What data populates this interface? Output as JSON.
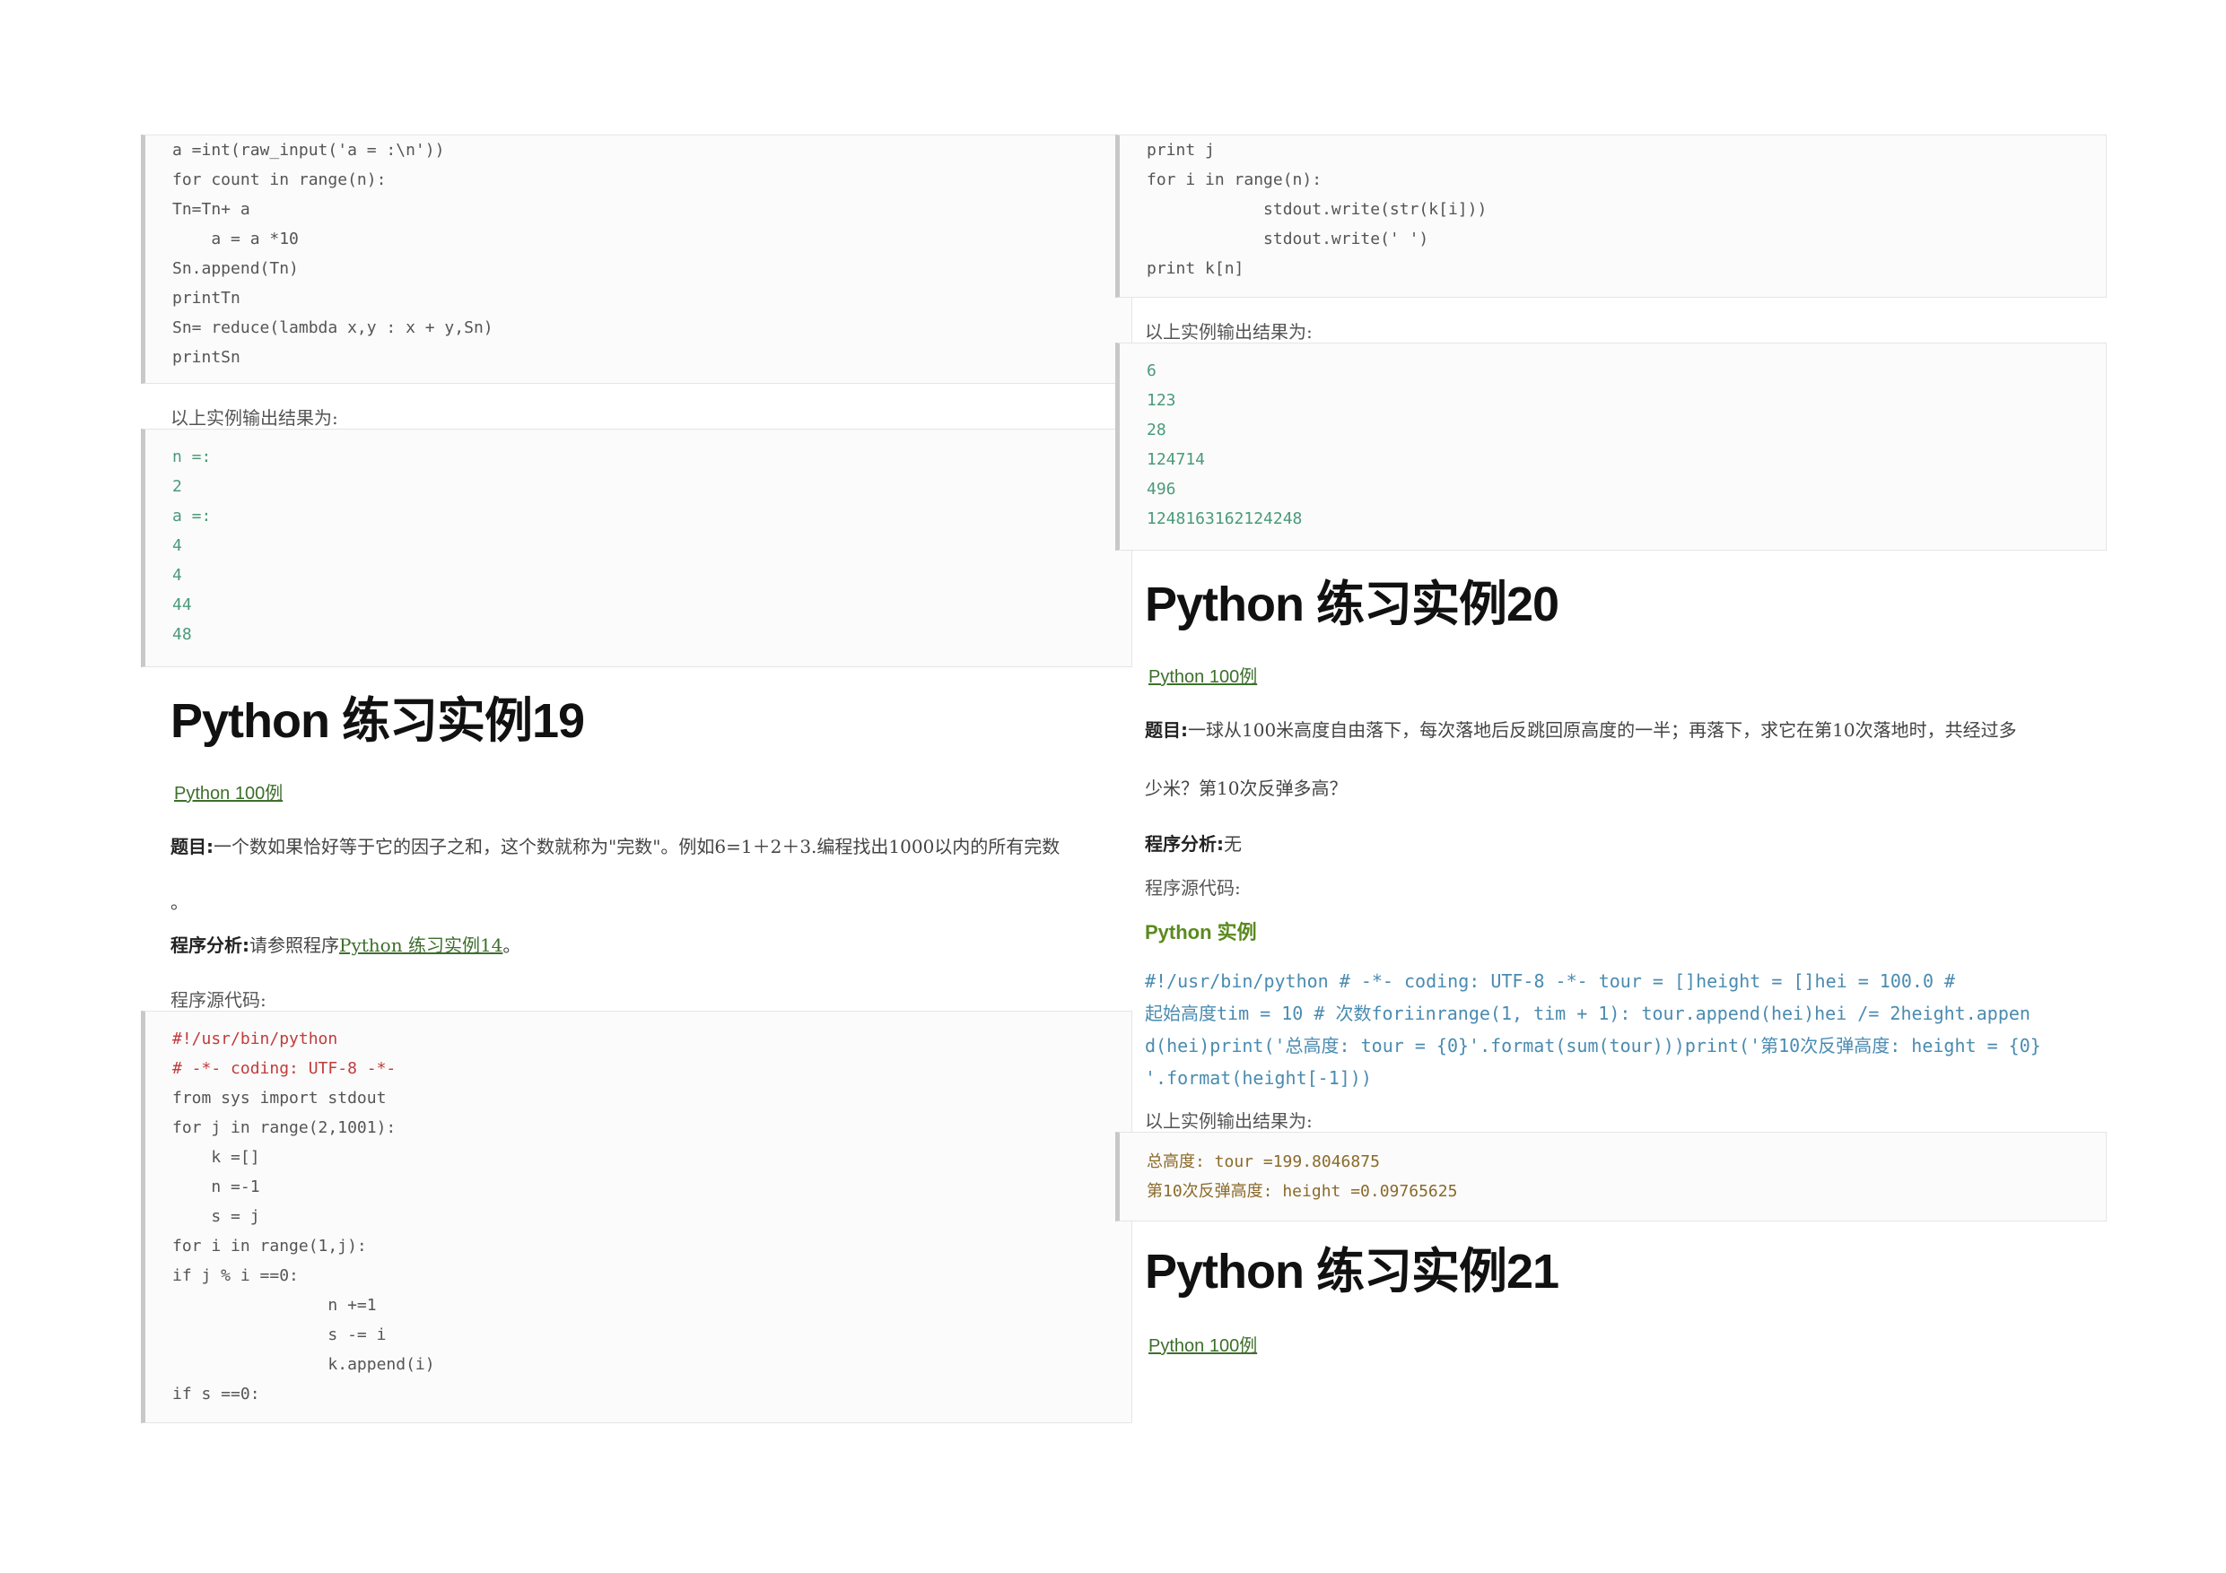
{
  "left": {
    "code_top_lines": [
      "a =int(raw_input('a = :\\n'))",
      "for count in range(n):",
      "Tn=Tn+ a",
      "    a = a *10",
      "Sn.append(Tn)",
      "printTn",
      "Sn= reduce(lambda x,y : x + y,Sn)",
      "printSn"
    ],
    "output_label": "以上实例输出结果为:",
    "output_lines": [
      "n =:",
      "2",
      "a =:",
      "4",
      "4",
      "44",
      "48"
    ],
    "heading": "Python 练习实例19",
    "link": "Python 100例",
    "question_label": "题目:",
    "question_line1": "一个数如果恰好等于它的因子之和，这个数就称为\"完数\"。例如6=1＋2＋3.编程找出1000以内的所有完数",
    "question_line2": "。",
    "analysis_label": "程序分析:",
    "analysis_text": "请参照程序",
    "analysis_link": "Python 练习实例14",
    "analysis_end": "。",
    "source_label": "程序源代码:",
    "code_bottom_lines": [
      "#!/usr/bin/python",
      "# -*- coding: UTF-8 -*-",
      "from sys import stdout",
      "for j in range(2,1001):",
      "    k =[]",
      "    n =-1",
      "    s = j",
      "for i in range(1,j):",
      "if j % i ==0:",
      "                n +=1",
      "                s -= i",
      "                k.append(i)",
      "if s ==0:"
    ]
  },
  "right": {
    "code_top_lines": [
      "print j",
      "for i in range(n):",
      "            stdout.write(str(k[i]))",
      "            stdout.write(' ')",
      "print k[n]"
    ],
    "output_label": "以上实例输出结果为:",
    "output_lines": [
      "6",
      "123",
      "28",
      "124714",
      "496",
      "1248163162124248"
    ],
    "heading20": "Python 练习实例20",
    "link20": "Python 100例",
    "question_label": "题目:",
    "question_line1": "一球从100米高度自由落下，每次落地后反跳回原高度的一半；再落下，求它在第10次落地时，共经过多",
    "question_line2": "少米？第10次反弹多高？",
    "analysis_label": "程序分析:",
    "analysis_text": "无",
    "source_label": "程序源代码:",
    "example_label": "Python 实例",
    "inline_code": [
      "#!/usr/bin/python # -*- coding: UTF-8 -*- tour = []height = []hei = 100.0 #",
      "起始高度tim = 10 # 次数foriinrange(1, tim + 1): tour.append(hei)hei /= 2height.appen",
      "d(hei)print('总高度: tour = {0}'.format(sum(tour)))print('第10次反弹高度: height = {0}",
      "'.format(height[-1]))"
    ],
    "output_label2": "以上实例输出结果为:",
    "output2_lines": [
      "总高度: tour =199.8046875",
      "第10次反弹高度: height =0.09765625"
    ],
    "heading21": "Python 练习实例21",
    "link21": "Python 100例"
  }
}
